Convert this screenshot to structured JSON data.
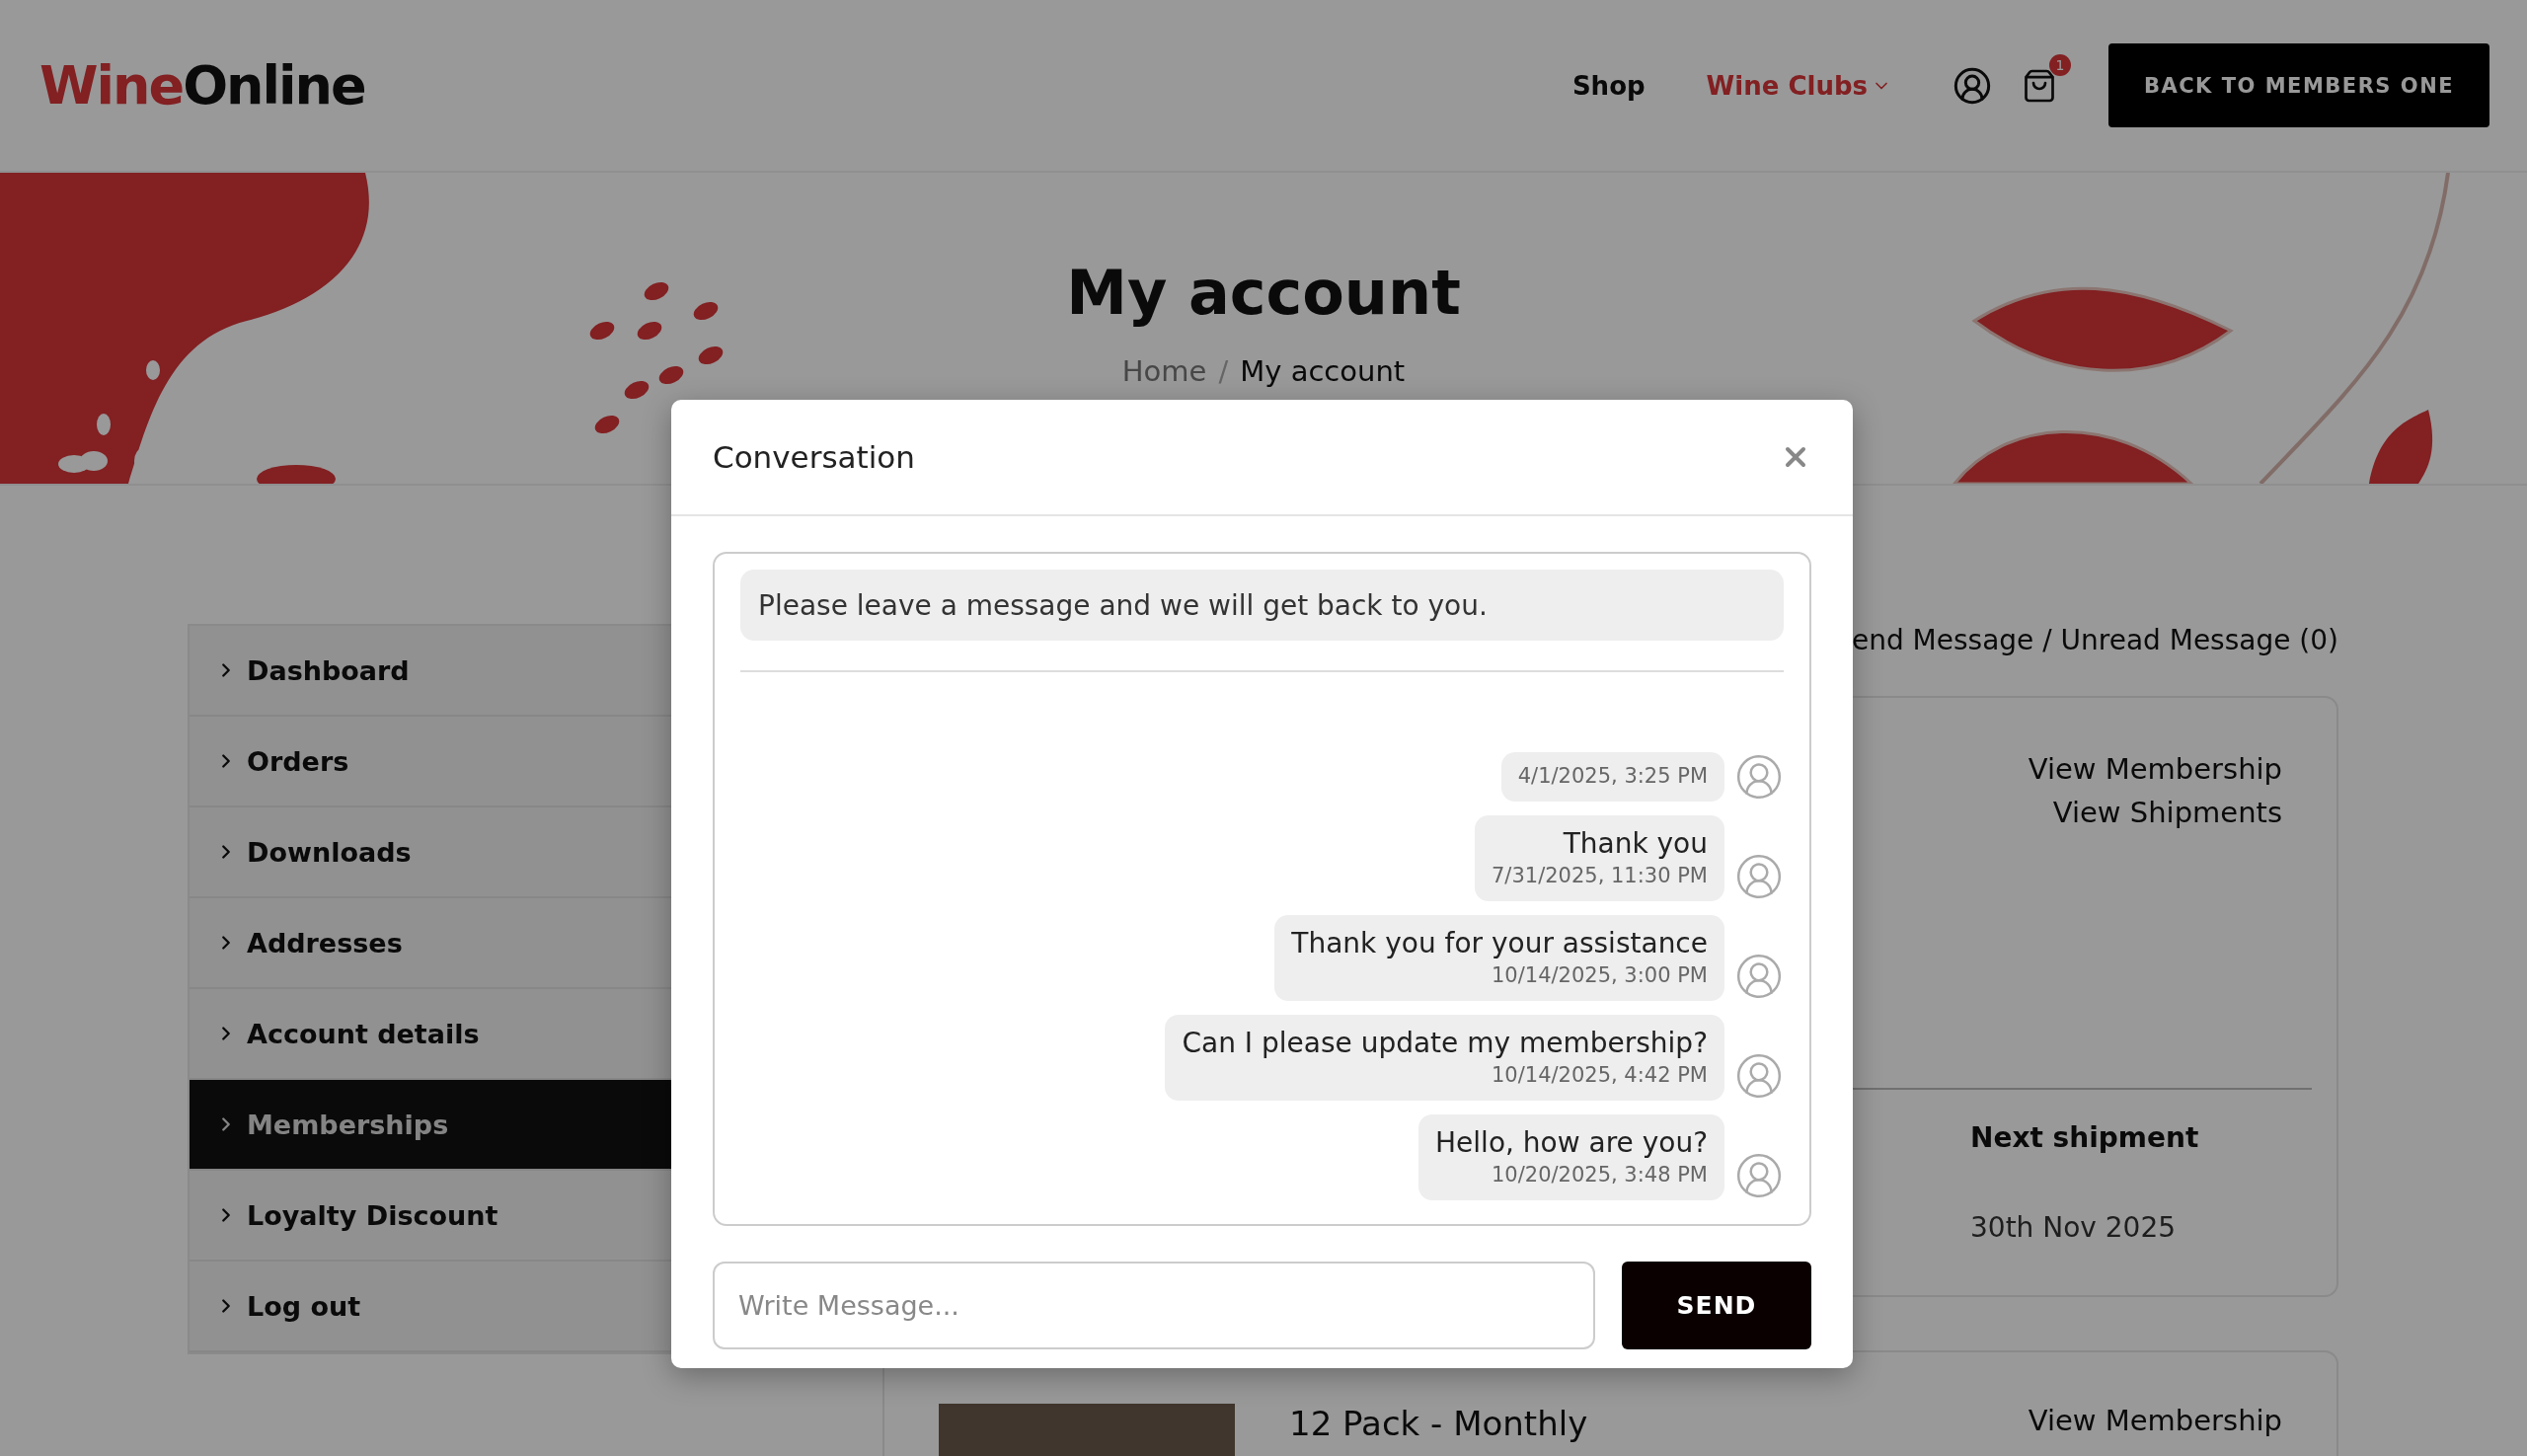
{
  "header": {
    "logo": {
      "part1": "Wine",
      "part2": "Online"
    },
    "nav": [
      {
        "label": "Shop",
        "selected": false,
        "dropdown": false
      },
      {
        "label": "Wine Clubs",
        "selected": true,
        "dropdown": true
      }
    ],
    "cart_count": "1",
    "cta": "BACK TO MEMBERS ONE"
  },
  "hero": {
    "title": "My account",
    "breadcrumb": [
      "Home",
      "My account"
    ],
    "separator": "/"
  },
  "sidebar": {
    "items": [
      {
        "label": "Dashboard",
        "selected": false
      },
      {
        "label": "Orders",
        "selected": false
      },
      {
        "label": "Downloads",
        "selected": false
      },
      {
        "label": "Addresses",
        "selected": false
      },
      {
        "label": "Account details",
        "selected": false
      },
      {
        "label": "Memberships",
        "selected": true
      },
      {
        "label": "Loyalty Discount",
        "selected": false
      },
      {
        "label": "Log out",
        "selected": false
      }
    ]
  },
  "content": {
    "messages_link": "end Message / Unread Message (0)",
    "membership_card": {
      "links": [
        "View Membership",
        "View Shipments"
      ],
      "next_shipment_label": "Next shipment",
      "next_shipment_date": "30th Nov 2025"
    },
    "second_card": {
      "title": "12 Pack - Monthly",
      "link": "View Membership"
    }
  },
  "modal": {
    "title": "Conversation",
    "notice": "Please leave a message and we will get back to you.",
    "messages": [
      {
        "date": "4/1/2025, 3:25 PM"
      },
      {
        "text": "Thank you",
        "date": "7/31/2025, 11:30 PM"
      },
      {
        "text": "Thank you for your assistance",
        "date": "10/14/2025, 3:00 PM"
      },
      {
        "text": "Can I please update my membership?",
        "date": "10/14/2025, 4:42 PM"
      },
      {
        "text": "Hello, how are you?",
        "date": "10/20/2025, 3:48 PM"
      }
    ],
    "input": {
      "placeholder": "Write Message..."
    },
    "send": "SEND"
  }
}
